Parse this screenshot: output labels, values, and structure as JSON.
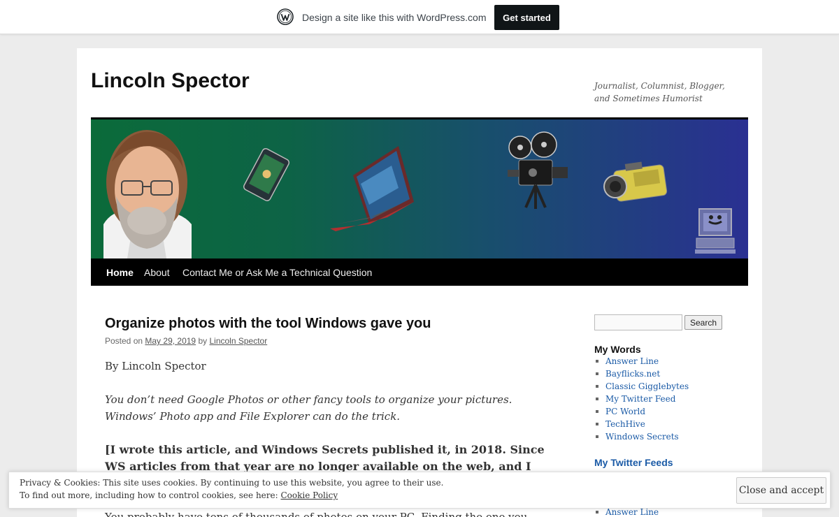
{
  "wpbar": {
    "text": "Design a site like this with WordPress.com",
    "cta": "Get started"
  },
  "site": {
    "title": "Lincoln Spector",
    "description": "Journalist, Columnist, Blogger, and Sometimes Humorist"
  },
  "nav": {
    "items": [
      "Home",
      "About",
      "Contact Me or Ask Me a Technical Question"
    ]
  },
  "post": {
    "title": "Organize photos with the tool Windows gave you",
    "meta_prefix": "Posted on",
    "date": "May 29, 2019",
    "meta_by": "by",
    "author": "Lincoln Spector",
    "paragraphs": [
      "By Lincoln Spector",
      "You don’t need Google Photos or other fancy tools to organize your pictures. Windows’ Photo app and File Explorer can do the trick.",
      "[I wrote this article, and Windows Secrets published it, in 2018. Since WS articles from that year are no longer available on the web, and I need to",
      "You probably have tens of thousands of photos on your PC. Finding the one you want is a"
    ]
  },
  "sidebar": {
    "search_button": "Search",
    "my_words_title": "My Words",
    "my_words": [
      "Answer Line",
      "Bayflicks.net",
      "Classic Gigglebytes",
      "My Twitter Feed",
      "PC World",
      "TechHive",
      "Windows Secrets"
    ],
    "twitter_title": "My Twitter Feeds",
    "twitter_items": [
      "Answer Line"
    ]
  },
  "cookie": {
    "line1": "Privacy & Cookies: This site uses cookies. By continuing to use this website, you agree to their use.",
    "line2_prefix": "To find out more, including how to control cookies, see here:",
    "policy_link": "Cookie Policy",
    "accept": "Close and accept"
  }
}
